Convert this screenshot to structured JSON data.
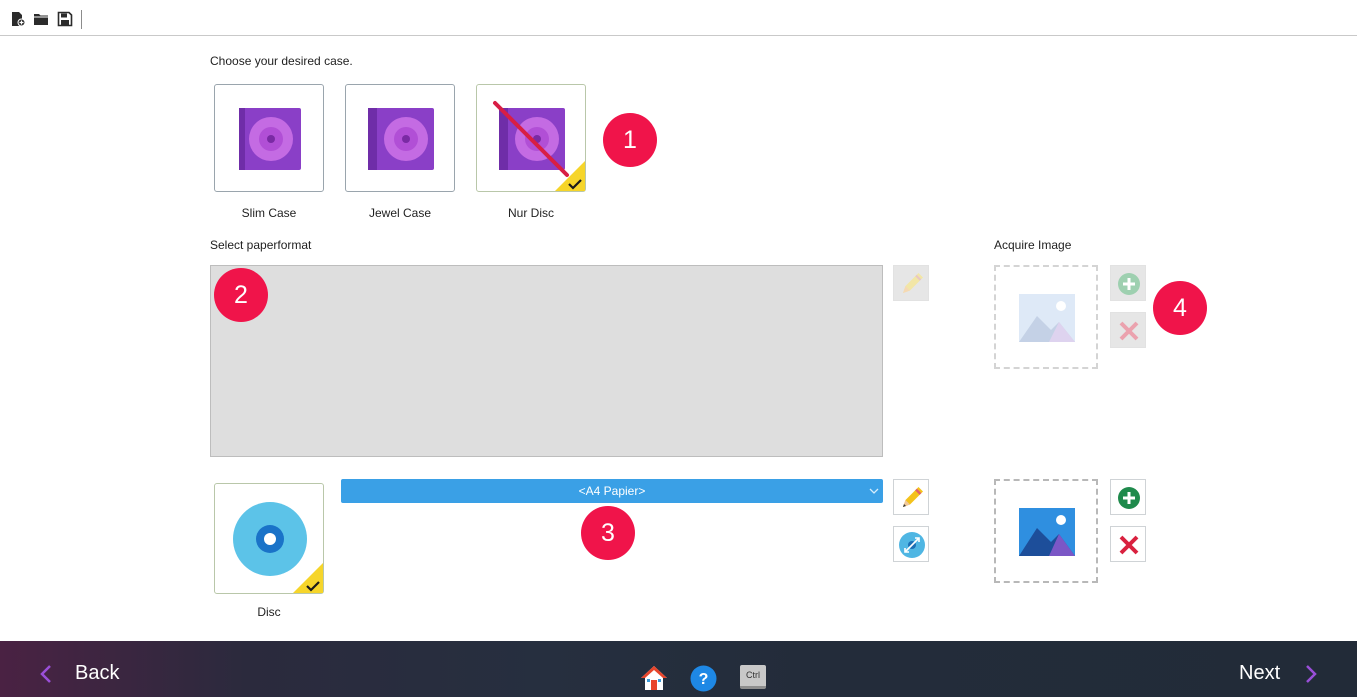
{
  "prompt_case": "Choose your desired case.",
  "cases": [
    {
      "label": "Slim Case",
      "selected": false
    },
    {
      "label": "Jewel Case",
      "selected": false
    },
    {
      "label": "Nur Disc",
      "selected": true
    }
  ],
  "select_paperformat_label": "Select paperformat",
  "acquire_image_label": "Acquire Image",
  "disc": {
    "label": "Disc",
    "selected": true
  },
  "paper_select": {
    "value": "<A4 Papier>"
  },
  "badges": [
    "1",
    "2",
    "3",
    "4"
  ],
  "footer": {
    "back": "Back",
    "next": "Next",
    "ctrl": "Ctrl"
  },
  "colors": {
    "accent_blue": "#3aa0e6",
    "badge_red": "#f0144a",
    "check_yellow": "#f6d52a",
    "case_purple": "#8a3fc7",
    "add_green": "#1f8a4c",
    "remove_red": "#d9213f"
  },
  "icons": {
    "toolbar": [
      "new-project-icon",
      "open-folder-icon",
      "save-icon"
    ],
    "footer": [
      "home-icon",
      "help-icon",
      "keyboard-ctrl-icon"
    ]
  }
}
